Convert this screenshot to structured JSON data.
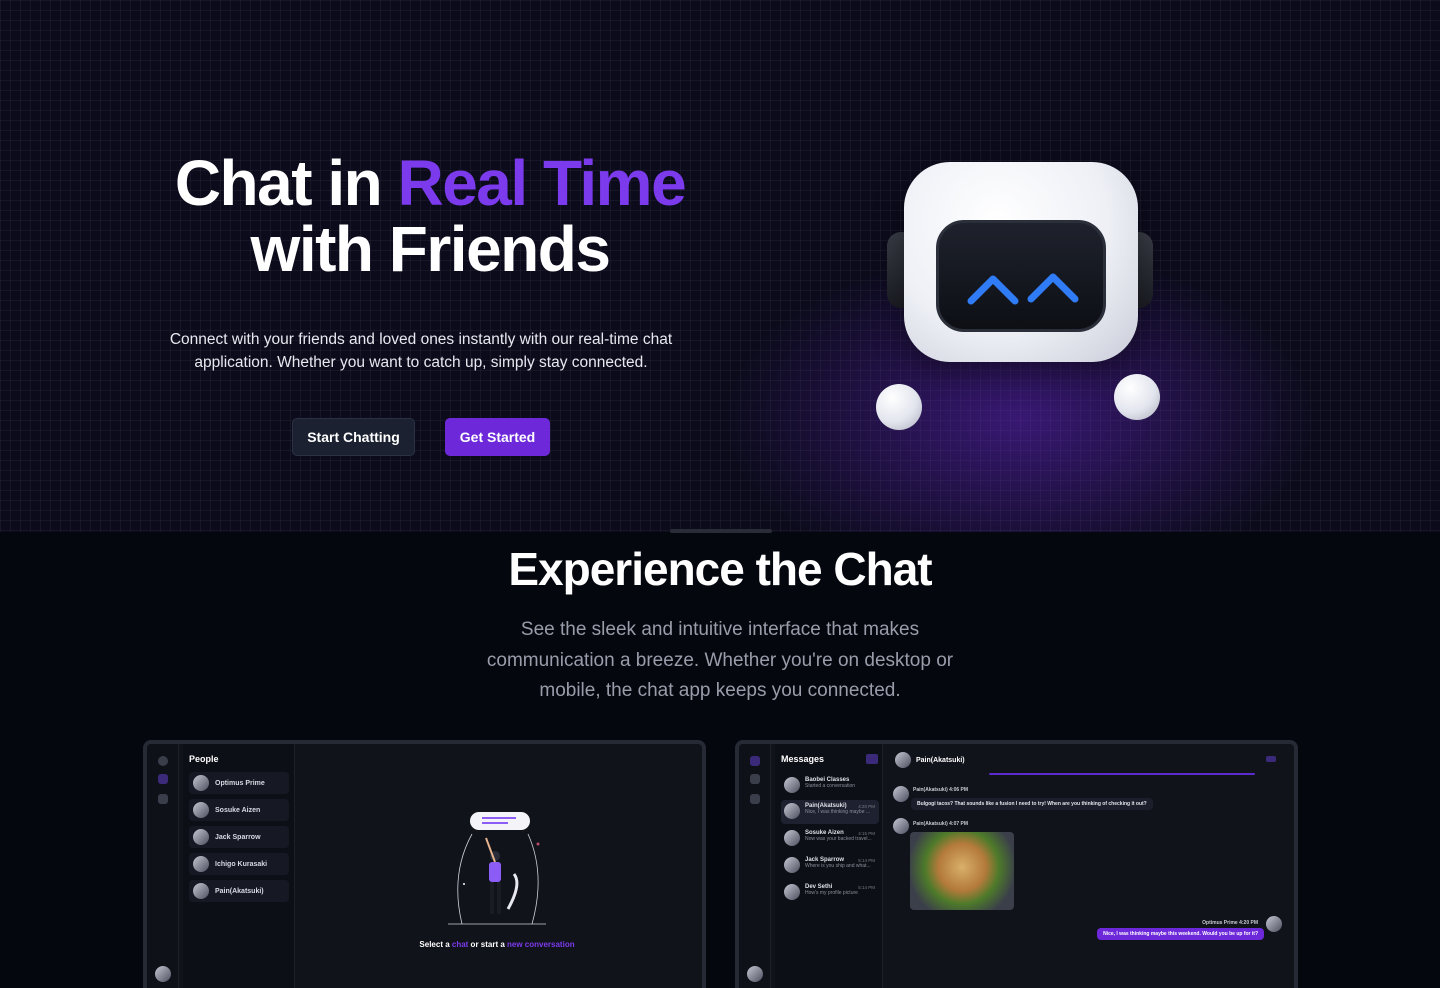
{
  "hero": {
    "title_line1_plain": "Chat in ",
    "title_line1_accent": "Real Time",
    "title_line2": "with Friends",
    "description": "Connect with your friends and loved ones instantly with our real-time chat application. Whether you want to catch up, simply stay connected.",
    "buttons": {
      "start_chatting": "Start Chatting",
      "get_started": "Get Started"
    }
  },
  "experience": {
    "title": "Experience the Chat",
    "description": "See the sleek and intuitive interface that makes communication a breeze. Whether you're on desktop or mobile, the chat app keeps you connected."
  },
  "preview_people": {
    "panel_title": "People",
    "people": [
      "Optimus Prime",
      "Sosuke Aizen",
      "Jack Sparrow",
      "Ichigo Kurasaki",
      "Pain(Akatsuki)"
    ],
    "empty_state": {
      "part1": "Select a ",
      "link1": "chat",
      "part2": " or start a ",
      "link2": "new conversation"
    }
  },
  "preview_messages": {
    "panel_title": "Messages",
    "chats": [
      {
        "name": "Baobei Classes",
        "preview": "Started a conversation",
        "time": ""
      },
      {
        "name": "Pain(Akatsuki)",
        "preview": "Nice, I was thinking maybe ...",
        "time": "4:20 PM"
      },
      {
        "name": "Sosuke Aizen",
        "preview": "Now was your backed travel...",
        "time": "4:15 PM"
      },
      {
        "name": "Jack Sparrow",
        "preview": "Where is you ship and what...",
        "time": "5:14 PM"
      },
      {
        "name": "Dev Sethi",
        "preview": "How's my profile picture",
        "time": "5:14 PM"
      }
    ],
    "conversation": {
      "header_name": "Pain(Akatsuki)",
      "msg1_meta": "Pain(Akatsuki) 4:06 PM",
      "msg1_text": "Bulgogi tacos? That sounds like a fusion I need to try! When are you thinking of checking it out?",
      "msg2_meta": "Pain(Akatsuki) 4:07 PM",
      "msg3_meta": "Optimus Prime 4:20 PM",
      "msg3_text": "Nice, I was thinking maybe this weekend. Would you be up for it?"
    }
  },
  "colors": {
    "accent": "#7c3aed",
    "button_purple": "#6d28d9",
    "button_dark": "#1b2130",
    "robot_eyes": "#2f7cf6"
  }
}
